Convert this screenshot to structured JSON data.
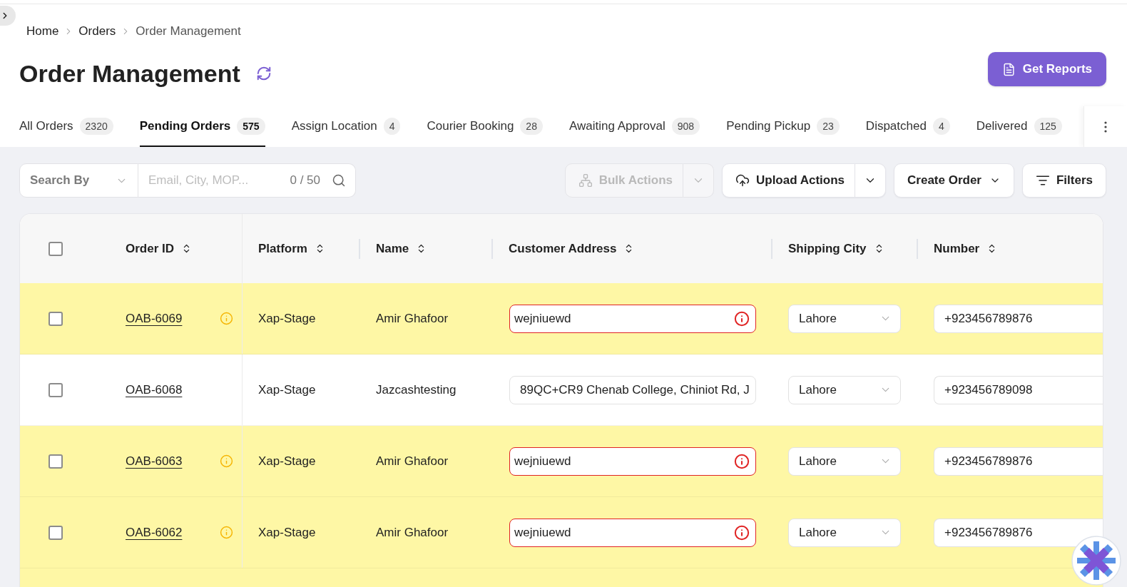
{
  "breadcrumb": [
    {
      "label": "Home",
      "current": false
    },
    {
      "label": "Orders",
      "current": false
    },
    {
      "label": "Order Management",
      "current": true
    }
  ],
  "header": {
    "title": "Order Management",
    "report_button": "Get Reports"
  },
  "tabs": [
    {
      "label": "All Orders",
      "count": "2320",
      "selected": false
    },
    {
      "label": "Pending Orders",
      "count": "575",
      "selected": true
    },
    {
      "label": "Assign Location",
      "count": "4",
      "selected": false
    },
    {
      "label": "Courier Booking",
      "count": "28",
      "selected": false
    },
    {
      "label": "Awaiting Approval",
      "count": "908",
      "selected": false
    },
    {
      "label": "Pending Pickup",
      "count": "23",
      "selected": false
    },
    {
      "label": "Dispatched",
      "count": "4",
      "selected": false
    },
    {
      "label": "Delivered",
      "count": "125",
      "selected": false
    }
  ],
  "search": {
    "search_by": "Search By",
    "placeholder": "Email, City, MOP...",
    "counter": "0 / 50"
  },
  "toolbar_buttons": [
    {
      "kind": "bulk",
      "label": "Bulk Actions",
      "disabled": true
    },
    {
      "kind": "upload",
      "label": "Upload Actions",
      "disabled": false
    },
    {
      "kind": "create",
      "label": "Create Order",
      "disabled": false
    },
    {
      "kind": "filter",
      "label": "Filters",
      "disabled": false
    }
  ],
  "table": {
    "select_all_checked": false,
    "columns": [
      {
        "label": "Order ID"
      },
      {
        "label": "Platform"
      },
      {
        "label": "Name"
      },
      {
        "label": "Customer Address"
      },
      {
        "label": "Shipping City"
      },
      {
        "label": "Number"
      }
    ],
    "rows": [
      {
        "checked": false,
        "flagged": true,
        "order_id": "OAB-6069",
        "platform": "Xap-Stage",
        "name": "Amir Ghafoor",
        "address": "wejniuewd",
        "address_invalid": true,
        "city": "Lahore",
        "number": "+923456789876"
      },
      {
        "checked": false,
        "flagged": false,
        "order_id": "OAB-6068",
        "platform": "Xap-Stage",
        "name": "Jazcashtesting",
        "address": "89QC+CR9 Chenab College, Chiniot Rd, J",
        "address_invalid": false,
        "city": "Lahore",
        "number": "+923456789098"
      },
      {
        "checked": false,
        "flagged": true,
        "order_id": "OAB-6063",
        "platform": "Xap-Stage",
        "name": "Amir Ghafoor",
        "address": "wejniuewd",
        "address_invalid": true,
        "city": "Lahore",
        "number": "+923456789876"
      },
      {
        "checked": false,
        "flagged": true,
        "order_id": "OAB-6062",
        "platform": "Xap-Stage",
        "name": "Amir Ghafoor",
        "address": "wejniuewd",
        "address_invalid": true,
        "city": "Lahore",
        "number": "+923456789876"
      },
      {
        "flagged": true
      }
    ]
  }
}
